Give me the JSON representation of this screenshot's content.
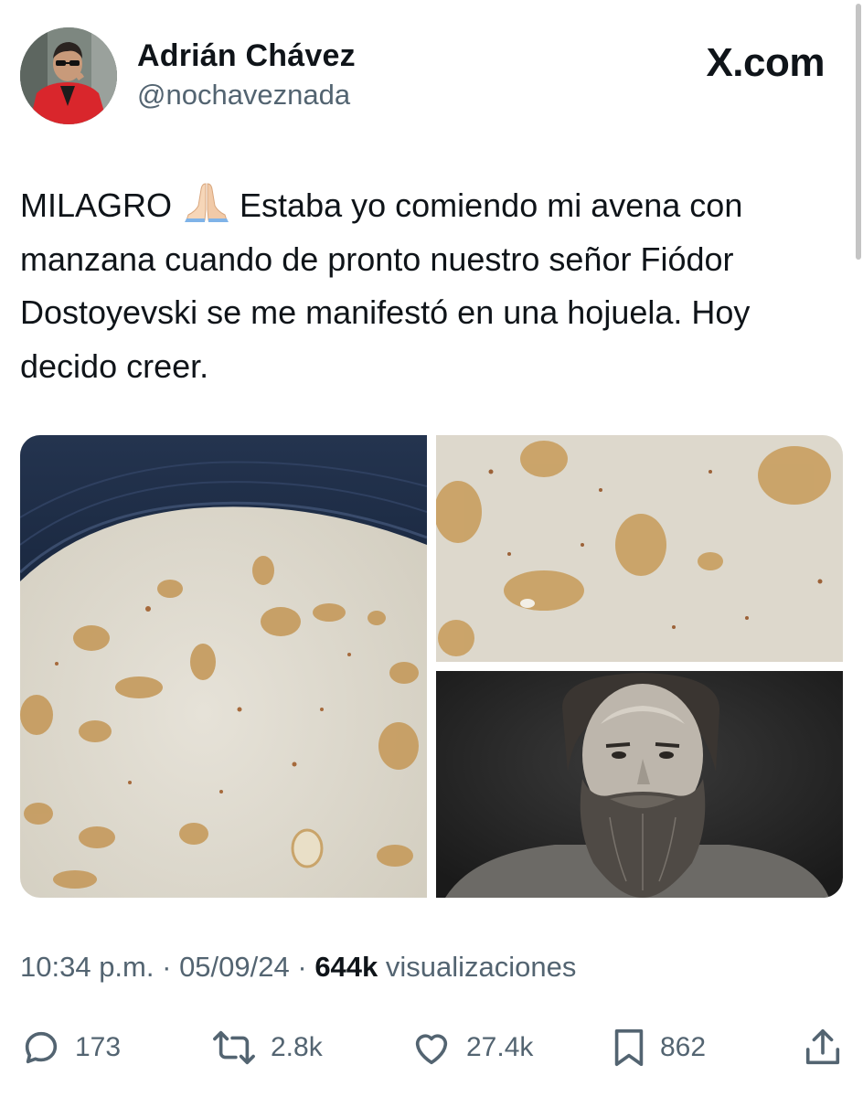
{
  "author": {
    "name": "Adrián Chávez",
    "handle": "@nochaveznada"
  },
  "brand": {
    "label": "X.com"
  },
  "tweet": {
    "text_before_emoji": "MILAGRO",
    "emoji_icon": "folded-hands-icon",
    "text_after_emoji": "Estaba yo comiendo mi avena con manzana cuando de pronto nuestro señor Fiódor Dostoyevski se me manifestó en una hojuela. Hoy decido creer."
  },
  "media": [
    {
      "kind": "photo",
      "depicts": "oatmeal-bowl-photo"
    },
    {
      "kind": "photo",
      "depicts": "oatmeal-flake-closeup-photo"
    },
    {
      "kind": "photo",
      "depicts": "dostoevsky-portrait-photo"
    }
  ],
  "meta": {
    "time": "10:34 p.m.",
    "separator": "·",
    "date": "05/09/24",
    "views_count": "644k",
    "views_label": "visualizaciones"
  },
  "actions": {
    "reply": {
      "icon": "reply-icon",
      "count": "173"
    },
    "retweet": {
      "icon": "retweet-icon",
      "count": "2.8k"
    },
    "like": {
      "icon": "heart-icon",
      "count": "27.4k"
    },
    "bookmark": {
      "icon": "bookmark-icon",
      "count": "862"
    },
    "share": {
      "icon": "share-icon"
    }
  },
  "colors": {
    "text": "#0f1419",
    "secondary": "#536471",
    "background": "#ffffff"
  }
}
